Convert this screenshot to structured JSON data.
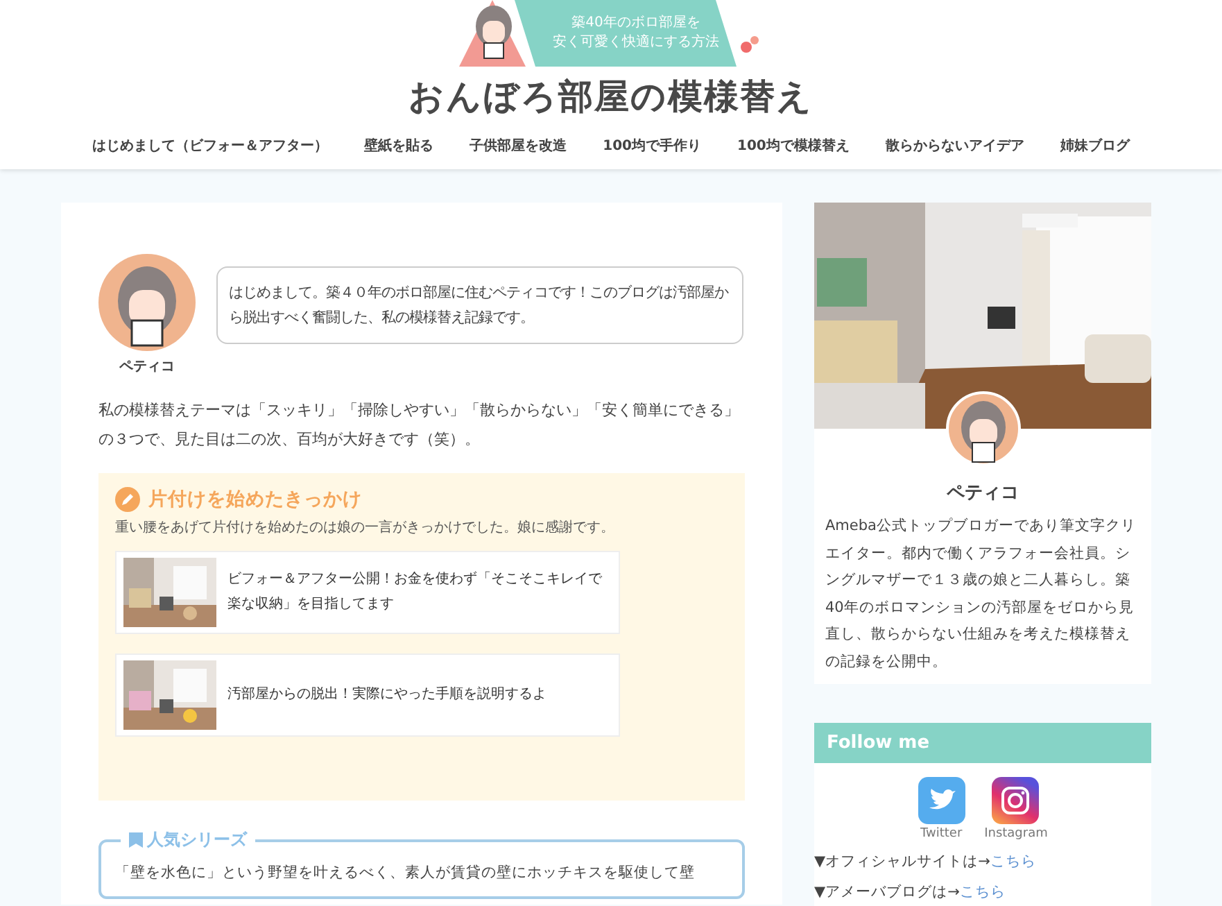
{
  "header": {
    "banner_lines": [
      "築40年のボロ部屋を",
      "安く可愛く快適にする方法"
    ],
    "site_title": "おんぼろ部屋の模様替え"
  },
  "nav": [
    {
      "label": "はじめまして（ビフォー＆アフター）"
    },
    {
      "label": "壁紙を貼る"
    },
    {
      "label": "子供部屋を改造"
    },
    {
      "label": "100均で手作り"
    },
    {
      "label": "100均で模様替え"
    },
    {
      "label": "散らからないアイデア"
    },
    {
      "label": "姉妹ブログ"
    }
  ],
  "intro": {
    "speaker": "ペティコ",
    "speech": "はじめまして。築４０年のボロ部屋に住むペティコです！このブログは汚部屋から脱出すべく奮闘した、私の模様替え記録です。",
    "paragraph": "私の模様替えテーマは「スッキリ」「掃除しやすい」「散らからない」「安く簡単にできる」の３つで、見た目は二の次、百均が大好きです（笑）。"
  },
  "trigger_box": {
    "heading": "片付けを始めたきっかけ",
    "text": "重い腰をあげて片付けを始めたのは娘の一言がきっかけでした。娘に感謝です。",
    "cards": [
      {
        "title": "ビフォー＆アフター公開！お金を使わず「そこそこキレイで楽な収納」を目指してます"
      },
      {
        "title": "汚部屋からの脱出！実際にやった手順を説明するよ"
      }
    ]
  },
  "popular_box": {
    "heading": "人気シリーズ",
    "text": "「壁を水色に」という野望を叶えるべく、素人が賃貸の壁にホッチキスを駆使して壁"
  },
  "profile": {
    "name": "ペティコ",
    "bio": "Ameba公式トップブロガーであり筆文字クリエイター。都内で働くアラフォー会社員。シングルマザーで１３歳の娘と二人暮らし。築40年のボロマンションの汚部屋をゼロから見直し、散らからない仕組みを考えた模様替えの記録を公開中。"
  },
  "follow": {
    "heading": "Follow me",
    "socials": [
      {
        "kind": "twitter",
        "label": "Twitter"
      },
      {
        "kind": "instagram",
        "label": "Instagram"
      }
    ],
    "links": [
      {
        "text": "▼オフィシャルサイトは→",
        "link": "こちら"
      },
      {
        "text": "▼アメーバブログは→",
        "link": "こちら"
      }
    ]
  }
}
